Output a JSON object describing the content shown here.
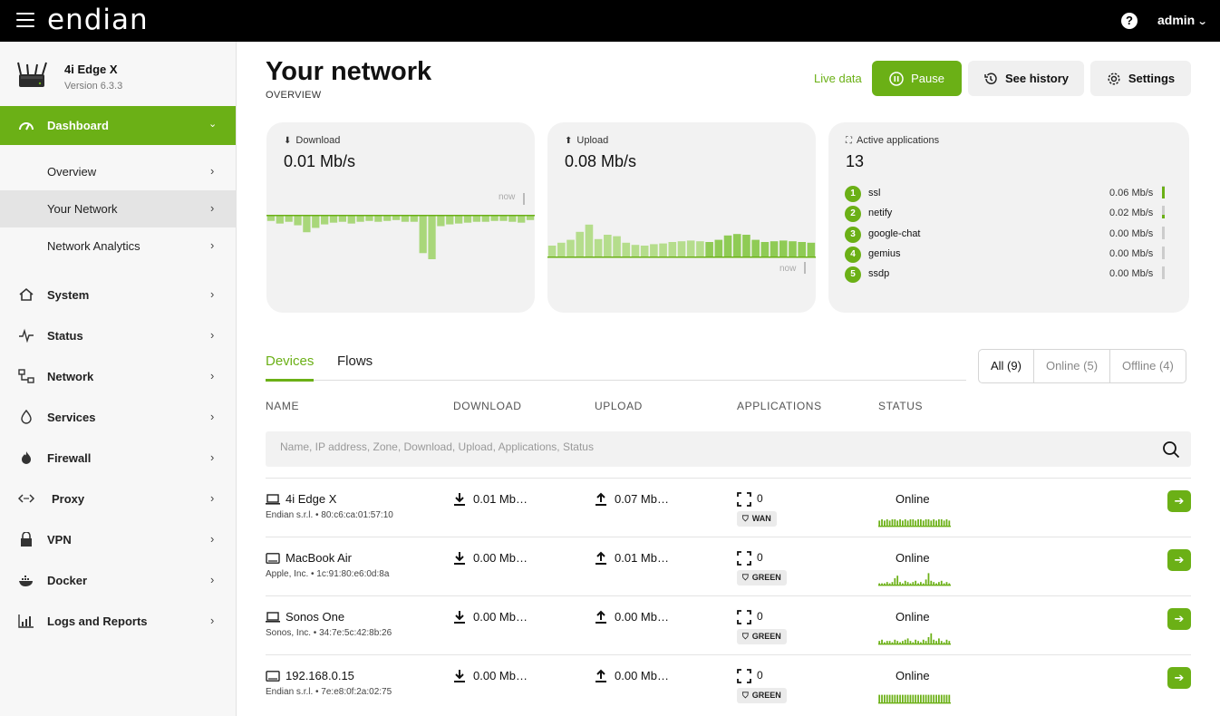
{
  "topbar": {
    "brand": "endian",
    "user": "admin",
    "help_icon": "question-circle-icon"
  },
  "sidebar": {
    "device": {
      "name": "4i Edge X",
      "version": "Version 6.3.3"
    },
    "dashboard_label": "Dashboard",
    "subitems": [
      {
        "label": "Overview"
      },
      {
        "label": "Your Network"
      },
      {
        "label": "Network Analytics"
      }
    ],
    "items": [
      {
        "label": "System",
        "icon": "home-icon"
      },
      {
        "label": "Status",
        "icon": "pulse-icon"
      },
      {
        "label": "Network",
        "icon": "network-icon"
      },
      {
        "label": "Services",
        "icon": "drop-icon"
      },
      {
        "label": "Firewall",
        "icon": "flame-icon"
      },
      {
        "label": "Proxy",
        "icon": "code-arrows-icon"
      },
      {
        "label": "VPN",
        "icon": "lock-icon"
      },
      {
        "label": "Docker",
        "icon": "docker-icon"
      },
      {
        "label": "Logs and Reports",
        "icon": "chart-icon"
      }
    ],
    "accent": "#6bb016"
  },
  "header": {
    "title": "Your network",
    "subtitle": "OVERVIEW",
    "live_label": "Live data",
    "pause_label": "Pause",
    "history_label": "See history",
    "settings_label": "Settings"
  },
  "cards": {
    "download": {
      "label": "Download",
      "value": "0.01 Mb/s",
      "now": "now",
      "bars": [
        0.12,
        0.18,
        0.14,
        0.22,
        0.38,
        0.28,
        0.2,
        0.16,
        0.14,
        0.18,
        0.14,
        0.12,
        0.14,
        0.12,
        0.1,
        0.14,
        0.14,
        0.86,
        1.0,
        0.24,
        0.2,
        0.18,
        0.16,
        0.14,
        0.14,
        0.12,
        0.12,
        0.14,
        0.16,
        0.1
      ]
    },
    "upload": {
      "label": "Upload",
      "value": "0.08 Mb/s",
      "now": "now",
      "bars": [
        0.3,
        0.38,
        0.46,
        0.68,
        0.88,
        0.48,
        0.6,
        0.56,
        0.38,
        0.32,
        0.3,
        0.34,
        0.36,
        0.4,
        0.42,
        0.44,
        0.42,
        0.4,
        0.46,
        0.58,
        0.62,
        0.6,
        0.46,
        0.4,
        0.42,
        0.44,
        0.42,
        0.4,
        0.38
      ]
    },
    "apps": {
      "label": "Active applications",
      "value": "13",
      "list": [
        {
          "rank": "1",
          "name": "ssl",
          "rate": "0.06 Mb/s",
          "level": 0.9
        },
        {
          "rank": "2",
          "name": "netify",
          "rate": "0.02 Mb/s",
          "level": 0.3
        },
        {
          "rank": "3",
          "name": "google-chat",
          "rate": "0.00 Mb/s",
          "level": 0.0
        },
        {
          "rank": "4",
          "name": "gemius",
          "rate": "0.00 Mb/s",
          "level": 0.0
        },
        {
          "rank": "5",
          "name": "ssdp",
          "rate": "0.00 Mb/s",
          "level": 0.0
        }
      ]
    }
  },
  "tabs": [
    {
      "label": "Devices",
      "active": true
    },
    {
      "label": "Flows",
      "active": false
    }
  ],
  "filters": [
    {
      "label": "All (9)",
      "active": true
    },
    {
      "label": "Online (5)"
    },
    {
      "label": "Offline (4)"
    }
  ],
  "table": {
    "columns": [
      "NAME",
      "DOWNLOAD",
      "UPLOAD",
      "APPLICATIONS",
      "STATUS"
    ],
    "search_placeholder": "Name, IP address, Zone, Download, Upload, Applications, Status",
    "rows": [
      {
        "name": "4i Edge X",
        "meta": "Endian s.r.l. • 80:c6:ca:01:57:10",
        "icon": "laptop-icon",
        "download": "0.01 Mb…",
        "upload": "0.07 Mb…",
        "apps": "0",
        "zone": "WAN",
        "status": "Online",
        "spark": [
          0.4,
          0.5,
          0.4,
          0.5,
          0.4,
          0.5,
          0.5,
          0.4,
          0.5,
          0.4,
          0.5,
          0.4,
          0.5,
          0.5,
          0.4,
          0.5,
          0.5,
          0.4,
          0.5,
          0.5,
          0.4,
          0.5,
          0.4,
          0.5,
          0.5,
          0.4,
          0.5,
          0.4
        ]
      },
      {
        "name": "MacBook Air",
        "meta": "Apple, Inc. • 1c:91:80:e6:0d:8a",
        "icon": "tablet-icon",
        "download": "0.00 Mb…",
        "upload": "0.01 Mb…",
        "apps": "0",
        "zone": "GREEN",
        "status": "Online",
        "spark": [
          0.1,
          0.1,
          0.1,
          0.2,
          0.1,
          0.2,
          0.5,
          0.7,
          0.2,
          0.1,
          0.3,
          0.2,
          0.1,
          0.2,
          0.3,
          0.1,
          0.2,
          0.1,
          0.4,
          0.9,
          0.3,
          0.2,
          0.1,
          0.2,
          0.3,
          0.1,
          0.2,
          0.1
        ]
      },
      {
        "name": "Sonos One",
        "meta": "Sonos, Inc. • 34:7e:5c:42:8b:26",
        "icon": "laptop-icon",
        "download": "0.00 Mb…",
        "upload": "0.00 Mb…",
        "apps": "0",
        "zone": "GREEN",
        "status": "Online",
        "spark": [
          0.2,
          0.3,
          0.1,
          0.2,
          0.2,
          0.1,
          0.3,
          0.2,
          0.1,
          0.2,
          0.3,
          0.4,
          0.2,
          0.1,
          0.3,
          0.2,
          0.1,
          0.3,
          0.2,
          0.5,
          0.8,
          0.3,
          0.2,
          0.4,
          0.2,
          0.1,
          0.3,
          0.2
        ]
      },
      {
        "name": "192.168.0.15",
        "meta": "Endian s.r.l. • 7e:e8:0f:2a:02:75",
        "icon": "tablet-icon",
        "download": "0.00 Mb…",
        "upload": "0.00 Mb…",
        "apps": "0",
        "zone": "GREEN",
        "status": "Online",
        "spark": [
          0.6,
          0.6,
          0.6,
          0.6,
          0.6,
          0.6,
          0.6,
          0.6,
          0.6,
          0.6,
          0.6,
          0.6,
          0.6,
          0.6,
          0.6,
          0.6,
          0.6,
          0.6,
          0.6,
          0.6,
          0.6,
          0.6,
          0.6,
          0.6,
          0.6,
          0.6,
          0.6,
          0.6
        ]
      }
    ]
  }
}
